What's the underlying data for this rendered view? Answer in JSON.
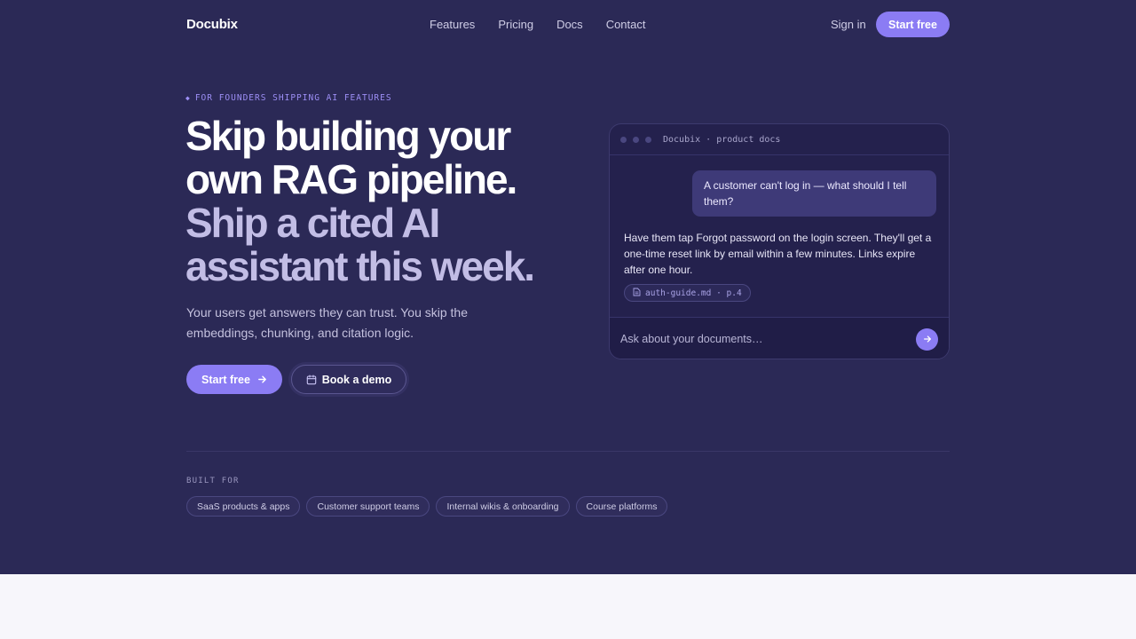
{
  "nav": {
    "logo": "Docubix",
    "links": [
      "Features",
      "Pricing",
      "Docs",
      "Contact"
    ],
    "sign_in": "Sign in",
    "cta": "Start free"
  },
  "hero": {
    "eyebrow": "FOR FOUNDERS SHIPPING AI FEATURES",
    "headline_lines": [
      "Skip building your",
      "own RAG pipeline.",
      "Ship a cited AI",
      "assistant this week."
    ],
    "subtitle": "Your users get answers they can trust. You skip the embeddings, chunking, and citation logic.",
    "primary_button": "Start free",
    "secondary_button": "Book a demo"
  },
  "chat": {
    "window_title": "Docubix · product docs",
    "user_message": "A customer can't log in — what should I tell them?",
    "assistant_message": "Have them tap Forgot password on the login screen. They'll get a one-time reset link by email within a few minutes. Links expire after one hour.",
    "citation": "auth-guide.md · p.4",
    "input_placeholder": "Ask about your documents…"
  },
  "built_for": {
    "label": "BUILT FOR",
    "tags": [
      "SaaS products & apps",
      "Customer support teams",
      "Internal wikis & onboarding",
      "Course platforms"
    ]
  },
  "colors": {
    "background": "#2b2956",
    "accent": "#8b7cf4",
    "muted_headline": "#c2bde5",
    "bottom_band": "#f7f6fb"
  },
  "icons": {
    "primary_button": "arrow-right-icon",
    "secondary_button": "calendar-icon",
    "citation": "document-icon",
    "send": "arrow-right-icon",
    "eyebrow": "diamond-icon"
  }
}
